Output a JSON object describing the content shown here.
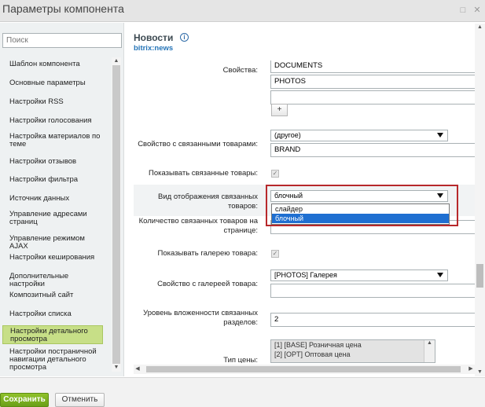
{
  "window": {
    "title": "Параметры компонента"
  },
  "sidebar": {
    "search_placeholder": "Поиск",
    "items": [
      {
        "label": "Шаблон компонента"
      },
      {
        "label": "Основные параметры"
      },
      {
        "label": "Настройки RSS"
      },
      {
        "label": "Настройки голосования"
      },
      {
        "label": "Настройка материалов по теме"
      },
      {
        "label": "Настройки отзывов"
      },
      {
        "label": "Настройки фильтра"
      },
      {
        "label": "Источник данных"
      },
      {
        "label": "Управление адресами страниц"
      },
      {
        "label": "Управление режимом AJAX"
      },
      {
        "label": "Настройки кеширования"
      },
      {
        "label": "Дополнительные настройки"
      },
      {
        "label": "Композитный сайт"
      },
      {
        "label": "Настройки списка"
      },
      {
        "label": "Настройки детального просмотра"
      },
      {
        "label": "Настройки постраничной навигации детального просмотра"
      }
    ]
  },
  "main": {
    "title": "Новости",
    "subtitle": "bitrix:news",
    "form": {
      "properties_label": "Свойства:",
      "properties_values": [
        "DOCUMENTS",
        "PHOTOS",
        ""
      ],
      "add_button": "+",
      "related_prop_label": "Свойство с связанными товарами:",
      "related_prop_select": "(другое)",
      "related_prop_value": "BRAND",
      "show_related_label": "Показывать связанные товары:",
      "related_view_label": "Вид отображения связанных товаров:",
      "related_view_select": "блочный",
      "related_view_options": [
        "слайдер",
        "блочный"
      ],
      "related_count_label": "Количество связанных товаров на странице:",
      "show_gallery_label": "Показывать галерею товара:",
      "gallery_prop_label": "Свойство с галереей товара:",
      "gallery_prop_select": "[PHOTOS] Галерея",
      "depth_label": "Уровень вложенности связанных разделов:",
      "depth_value": "2",
      "price_types_label": "Тип цены:",
      "price_types": [
        "[1] [BASE] Розничная цена",
        "[2] [OPT] Оптовая цена"
      ]
    }
  },
  "footer": {
    "save_label": "Сохранить",
    "cancel_label": "Отменить"
  }
}
